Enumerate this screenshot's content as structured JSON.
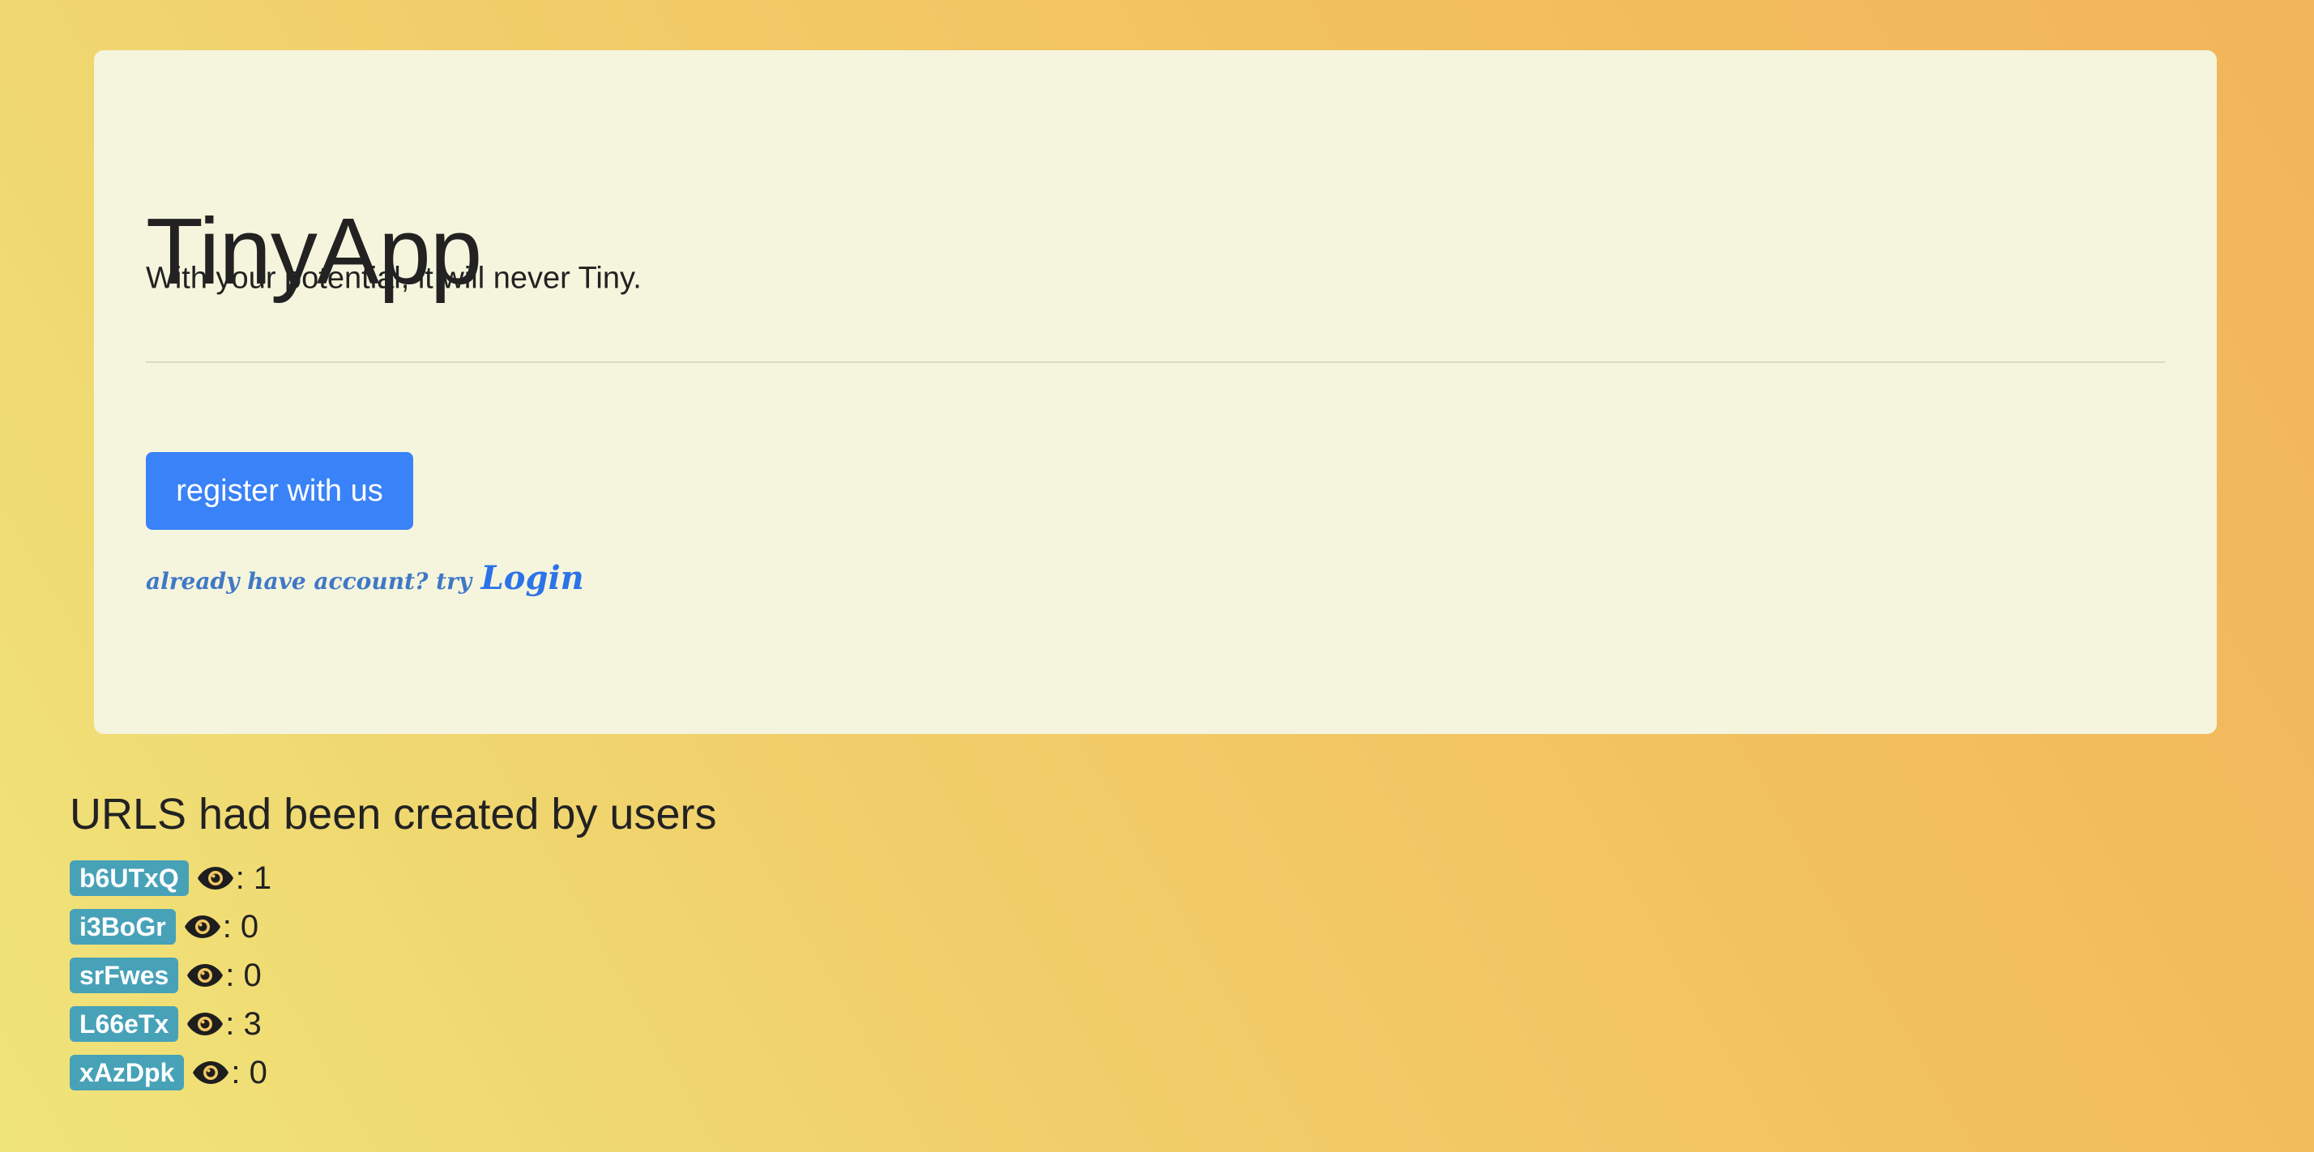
{
  "hero": {
    "title": "TinyApp",
    "tagline": "With your potential, it will never Tiny.",
    "register_label": "register with us",
    "login_hint": "already have account? try",
    "login_label": "Login"
  },
  "urls": {
    "heading": "URLS had been created by users",
    "items": [
      {
        "id": "b6UTxQ",
        "views": ": 1"
      },
      {
        "id": "i3BoGr",
        "views": ": 0"
      },
      {
        "id": "srFwes",
        "views": ": 0"
      },
      {
        "id": "L66eTx",
        "views": ": 3"
      },
      {
        "id": "xAzDpk",
        "views": ": 0"
      }
    ]
  },
  "icons": {
    "views_icon": "eye-icon"
  },
  "colors": {
    "primary_button": "#3a82f7",
    "badge": "#47a2b8",
    "login_link": "#2b73e8",
    "panel": "#f5f5de"
  }
}
